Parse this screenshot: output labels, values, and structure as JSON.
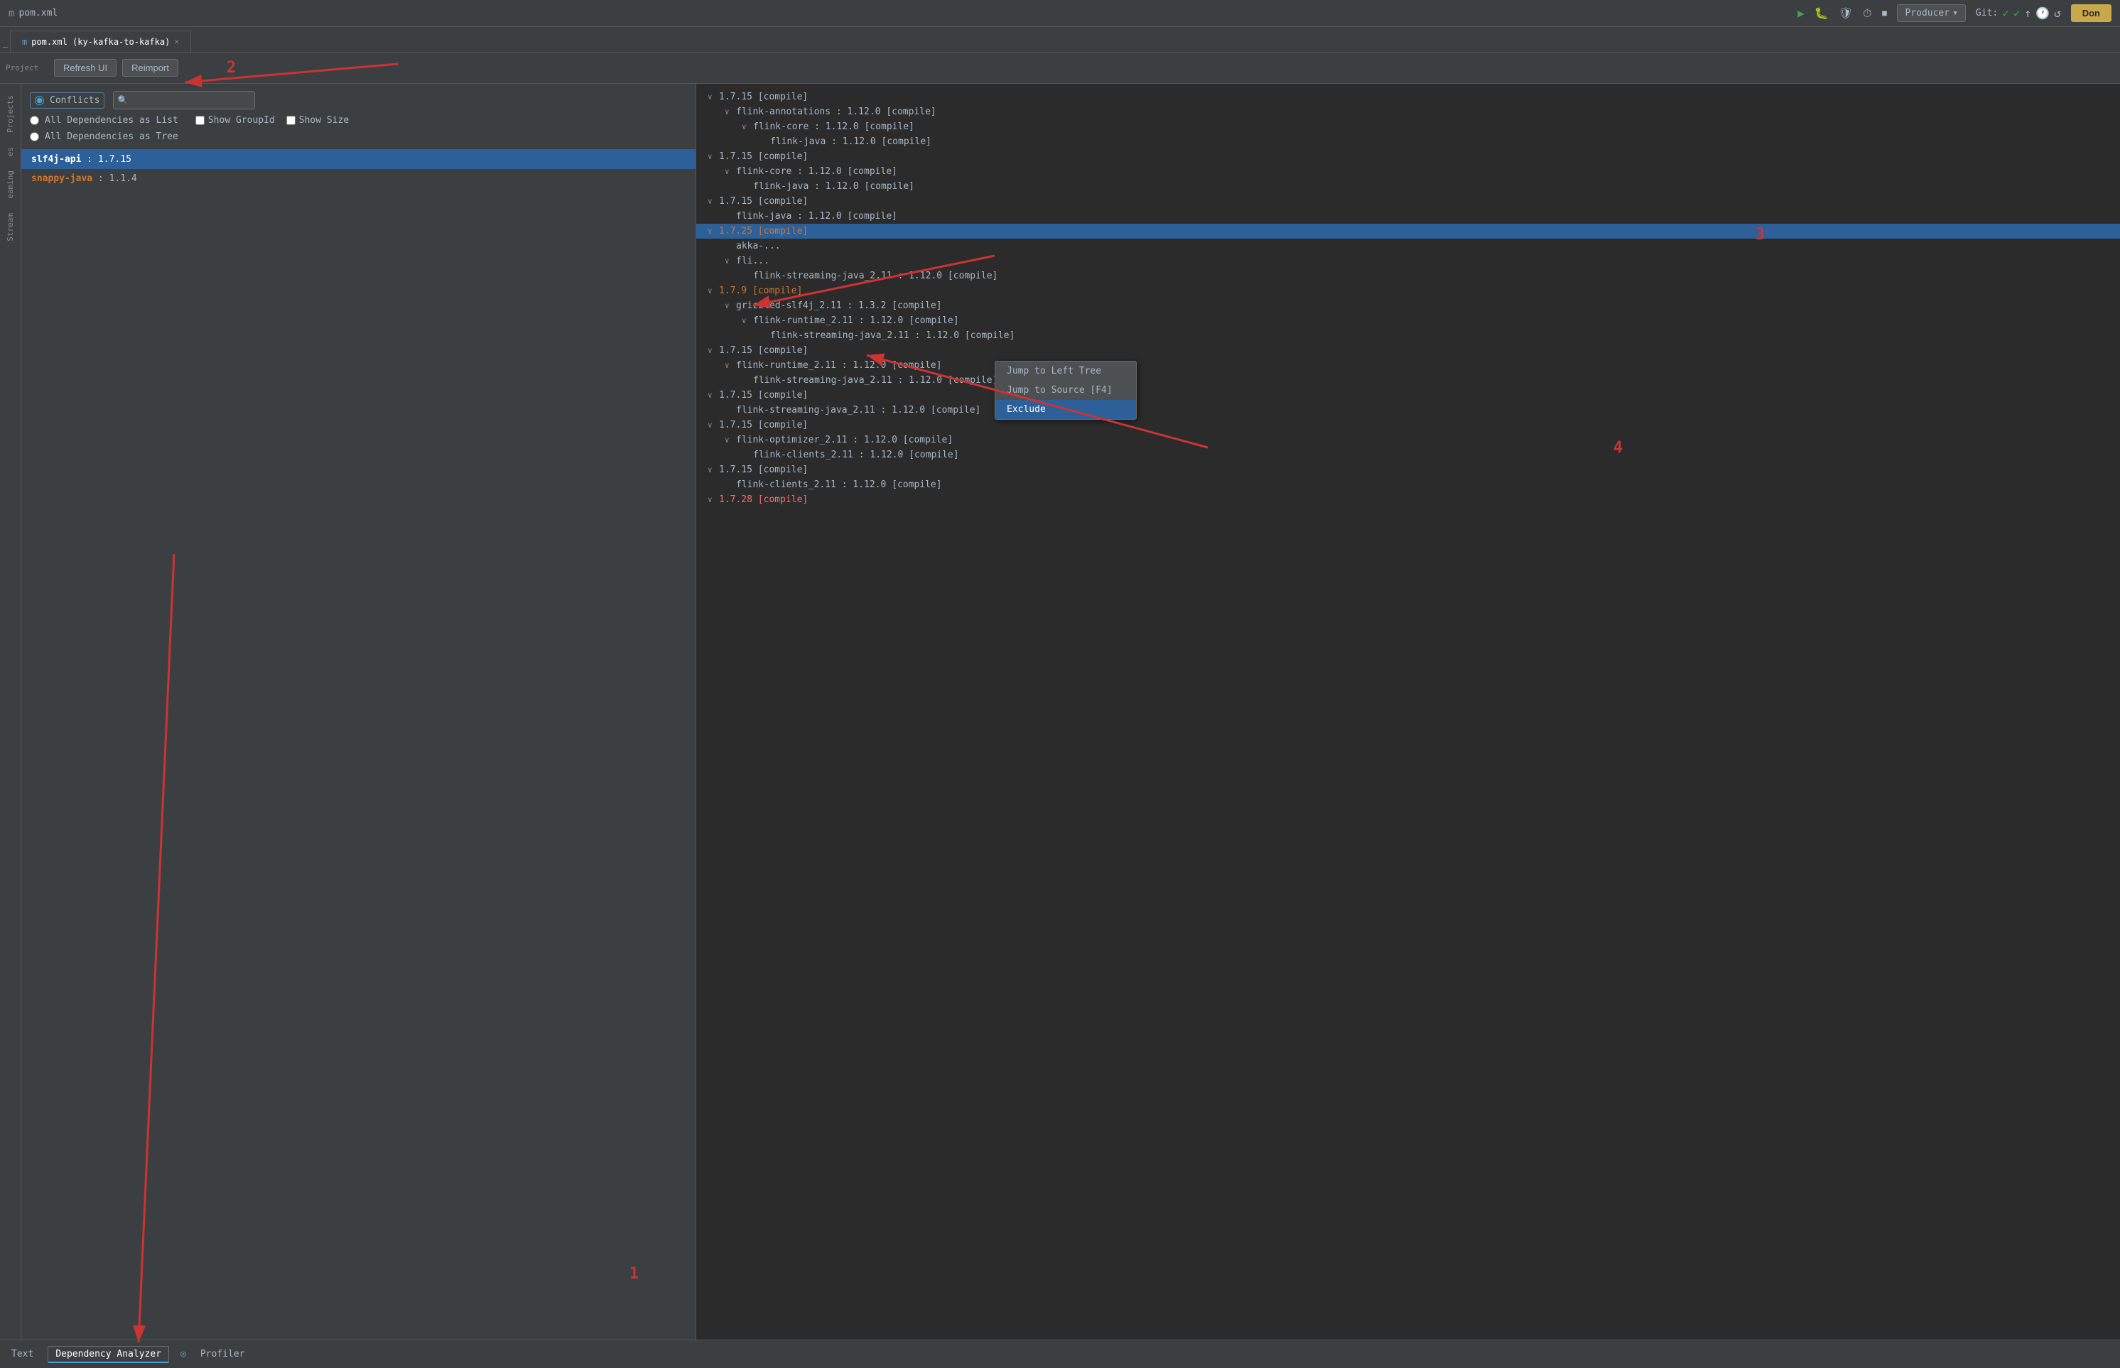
{
  "titleBar": {
    "icon": "m",
    "text": "pom.xml"
  },
  "topToolbar": {
    "refreshBtn": "Refresh UI",
    "reimportBtn": "Reimport"
  },
  "tabs": [
    {
      "label": "pom.xml (ky-kafka-to-kafka)",
      "active": true
    }
  ],
  "leftPanel": {
    "conflictsLabel": "Conflicts",
    "allDepsListLabel": "All Dependencies as List",
    "allDepsTreeLabel": "All Dependencies as Tree",
    "searchPlaceholder": "🔍",
    "showGroupIdLabel": "Show GroupId",
    "showSizeLabel": "Show Size",
    "dependencies": [
      {
        "name": "slf4j-api",
        "version": "1.7.15",
        "selected": true
      },
      {
        "name": "snappy-java",
        "version": "1.1.4",
        "selected": false
      }
    ]
  },
  "rightPanel": {
    "treeItems": [
      {
        "indent": 0,
        "arrow": "∨",
        "text": "1.7.15 [compile]",
        "type": "normal"
      },
      {
        "indent": 1,
        "arrow": "∨",
        "text": "flink-annotations : 1.12.0 [compile]",
        "type": "normal"
      },
      {
        "indent": 2,
        "arrow": "∨",
        "text": "flink-core : 1.12.0 [compile]",
        "type": "normal"
      },
      {
        "indent": 3,
        "arrow": "",
        "text": "flink-java : 1.12.0 [compile]",
        "type": "normal"
      },
      {
        "indent": 0,
        "arrow": "∨",
        "text": "1.7.15 [compile]",
        "type": "normal"
      },
      {
        "indent": 1,
        "arrow": "∨",
        "text": "flink-core : 1.12.0 [compile]",
        "type": "normal"
      },
      {
        "indent": 2,
        "arrow": "",
        "text": "flink-java : 1.12.0 [compile]",
        "type": "normal"
      },
      {
        "indent": 0,
        "arrow": "∨",
        "text": "1.7.15 [compile]",
        "type": "normal"
      },
      {
        "indent": 1,
        "arrow": "",
        "text": "flink-java : 1.12.0 [compile]",
        "type": "normal"
      },
      {
        "indent": 0,
        "arrow": "∨",
        "text": "1.7.25 [compile]",
        "type": "highlight"
      },
      {
        "indent": 1,
        "arrow": "",
        "text": "akka-...",
        "type": "normal"
      },
      {
        "indent": 1,
        "arrow": "∨",
        "text": "fli...",
        "type": "normal"
      },
      {
        "indent": 2,
        "arrow": "",
        "text": "flink-streaming-java_2.11 : 1.12.0 [compile]",
        "type": "normal"
      },
      {
        "indent": 0,
        "arrow": "∨",
        "text": "1.7.9 [compile]",
        "type": "conflict"
      },
      {
        "indent": 1,
        "arrow": "∨",
        "text": "grizzled-slf4j_2.11 : 1.3.2 [compile]",
        "type": "normal"
      },
      {
        "indent": 2,
        "arrow": "∨",
        "text": "flink-runtime_2.11 : 1.12.0 [compile]",
        "type": "normal"
      },
      {
        "indent": 3,
        "arrow": "",
        "text": "flink-streaming-java_2.11 : 1.12.0 [compile]",
        "type": "normal"
      },
      {
        "indent": 0,
        "arrow": "∨",
        "text": "1.7.15 [compile]",
        "type": "normal"
      },
      {
        "indent": 1,
        "arrow": "∨",
        "text": "flink-runtime_2.11 : 1.12.0 [compile]",
        "type": "normal"
      },
      {
        "indent": 2,
        "arrow": "",
        "text": "flink-streaming-java_2.11 : 1.12.0 [compile]",
        "type": "normal"
      },
      {
        "indent": 0,
        "arrow": "∨",
        "text": "1.7.15 [compile]",
        "type": "normal"
      },
      {
        "indent": 1,
        "arrow": "",
        "text": "flink-streaming-java_2.11 : 1.12.0 [compile]",
        "type": "normal"
      },
      {
        "indent": 0,
        "arrow": "∨",
        "text": "1.7.15 [compile]",
        "type": "normal"
      },
      {
        "indent": 1,
        "arrow": "∨",
        "text": "flink-optimizer_2.11 : 1.12.0 [compile]",
        "type": "normal"
      },
      {
        "indent": 2,
        "arrow": "",
        "text": "flink-clients_2.11 : 1.12.0 [compile]",
        "type": "normal"
      },
      {
        "indent": 0,
        "arrow": "∨",
        "text": "1.7.15 [compile]",
        "type": "normal"
      },
      {
        "indent": 1,
        "arrow": "",
        "text": "flink-clients_2.11 : 1.12.0 [compile]",
        "type": "normal"
      },
      {
        "indent": 0,
        "arrow": "∨",
        "text": "1.7.28 [compile]",
        "type": "conflict-red"
      }
    ]
  },
  "contextMenu": {
    "items": [
      {
        "label": "Jump to Left Tree",
        "active": false
      },
      {
        "label": "Jump to Source [F4]",
        "active": false
      },
      {
        "label": "Exclude",
        "active": true
      }
    ]
  },
  "bottomBar": {
    "textLabel": "Text",
    "depAnalyzerLabel": "Dependency Analyzer",
    "profilerLabel": "Profiler"
  },
  "globalToolbar": {
    "producerLabel": "Producer",
    "gitLabel": "Git:",
    "donLabel": "Don"
  },
  "annotations": {
    "num1": "1",
    "num2": "2",
    "num3": "3",
    "num4": "4"
  }
}
